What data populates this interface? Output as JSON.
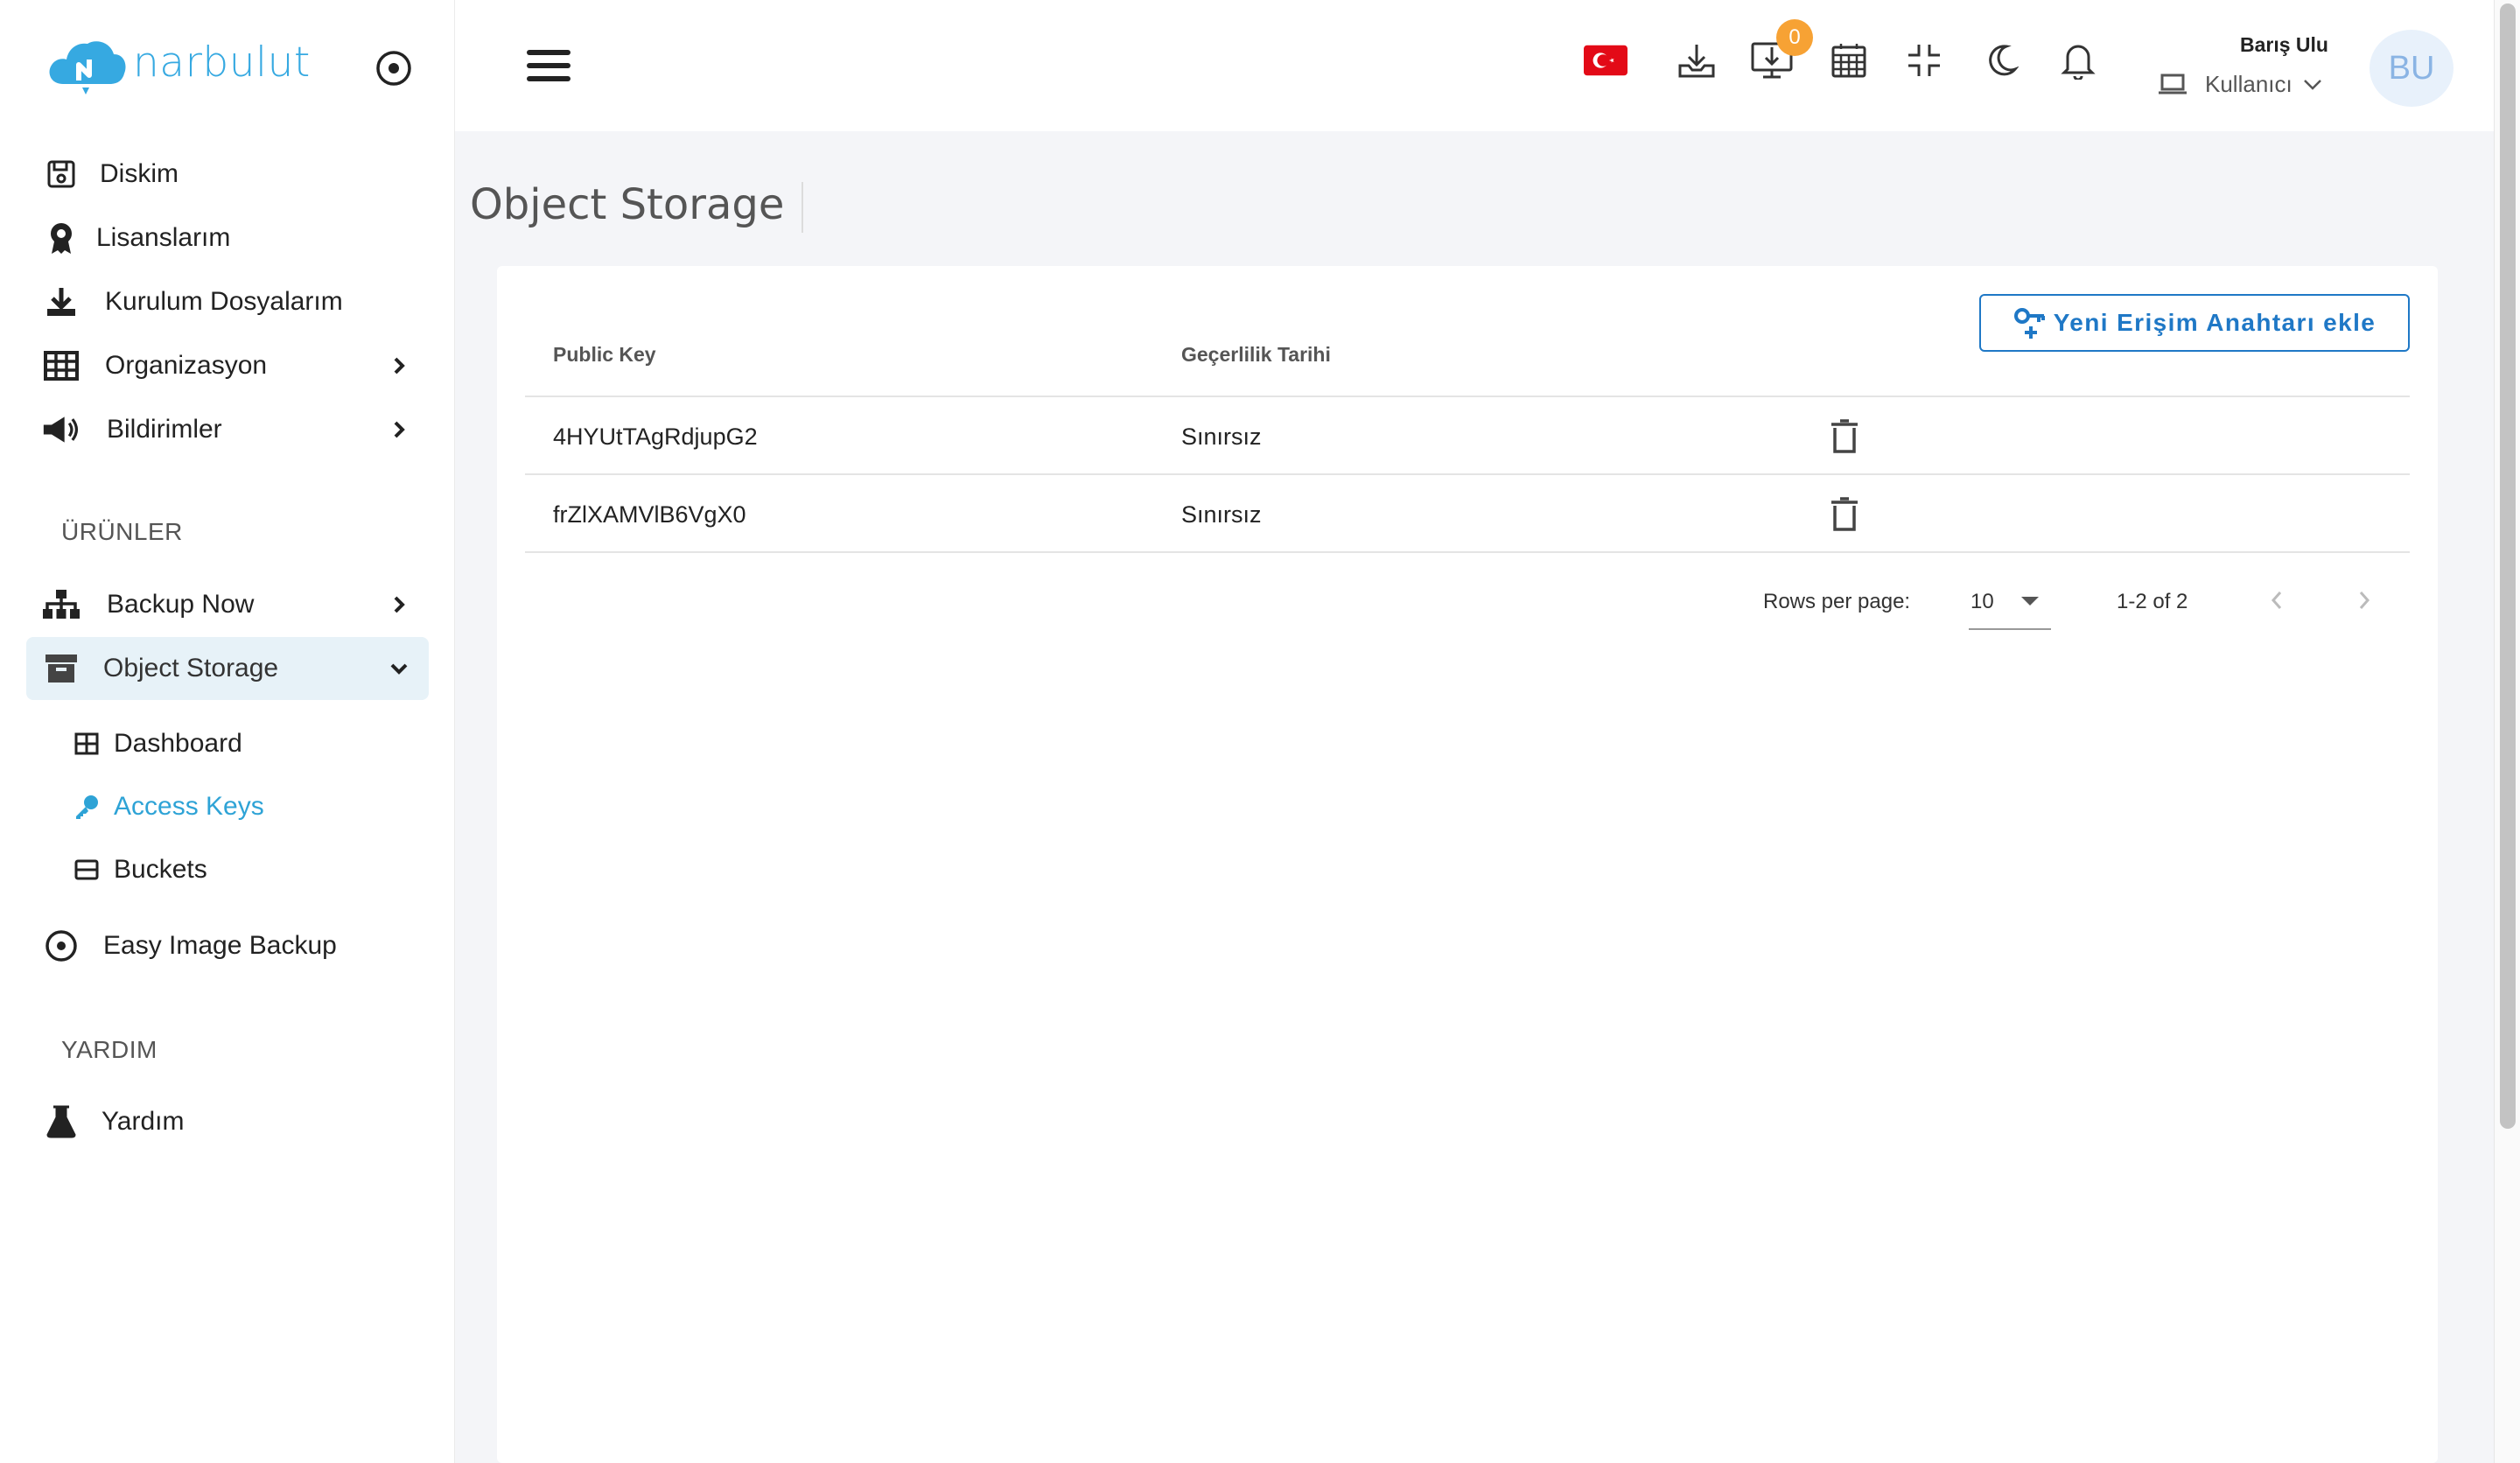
{
  "brand": {
    "name": "narbulut",
    "color": "#36a9e1"
  },
  "sidebar": {
    "items": [
      {
        "label": "Diskim",
        "icon": "floppy-disk-icon"
      },
      {
        "label": "Lisanslarım",
        "icon": "award-icon"
      },
      {
        "label": "Kurulum Dosyalarım",
        "icon": "download-icon"
      },
      {
        "label": "Organizasyon",
        "icon": "grid-icon"
      },
      {
        "label": "Bildirimler",
        "icon": "megaphone-icon"
      }
    ],
    "section_products": "ÜRÜNLER",
    "products": [
      {
        "label": "Backup Now",
        "icon": "sitemap-icon"
      },
      {
        "label": "Object Storage",
        "icon": "archive-box-icon"
      }
    ],
    "object_storage_sub": [
      {
        "label": "Dashboard",
        "icon": "grid-small-icon"
      },
      {
        "label": "Access Keys",
        "icon": "key-icon"
      },
      {
        "label": "Buckets",
        "icon": "drive-icon"
      }
    ],
    "easy_image_backup": "Easy Image Backup",
    "section_help": "YARDIM",
    "help": "Yardım"
  },
  "header": {
    "notification_count": "0",
    "user_name": "Barış Ulu",
    "user_role": "Kullanıcı",
    "avatar_initials": "BU"
  },
  "page": {
    "title": "Object Storage",
    "add_key_button": "Yeni Erişim Anahtarı ekle"
  },
  "table": {
    "headers": [
      "Public Key",
      "Geçerlilik Tarihi"
    ],
    "rows": [
      {
        "public_key": "4HYUtTAgRdjupG2",
        "validity": "Sınırsız"
      },
      {
        "public_key": "frZlXAMVlB6VgX0",
        "validity": "Sınırsız"
      }
    ],
    "rows_per_page_label": "Rows per page:",
    "rows_per_page": "10",
    "range": "1-2 of 2"
  },
  "colors": {
    "accent": "#2ea3d6",
    "button": "#1f78c6",
    "badge": "#f7a234",
    "flag": "#e30a17"
  }
}
